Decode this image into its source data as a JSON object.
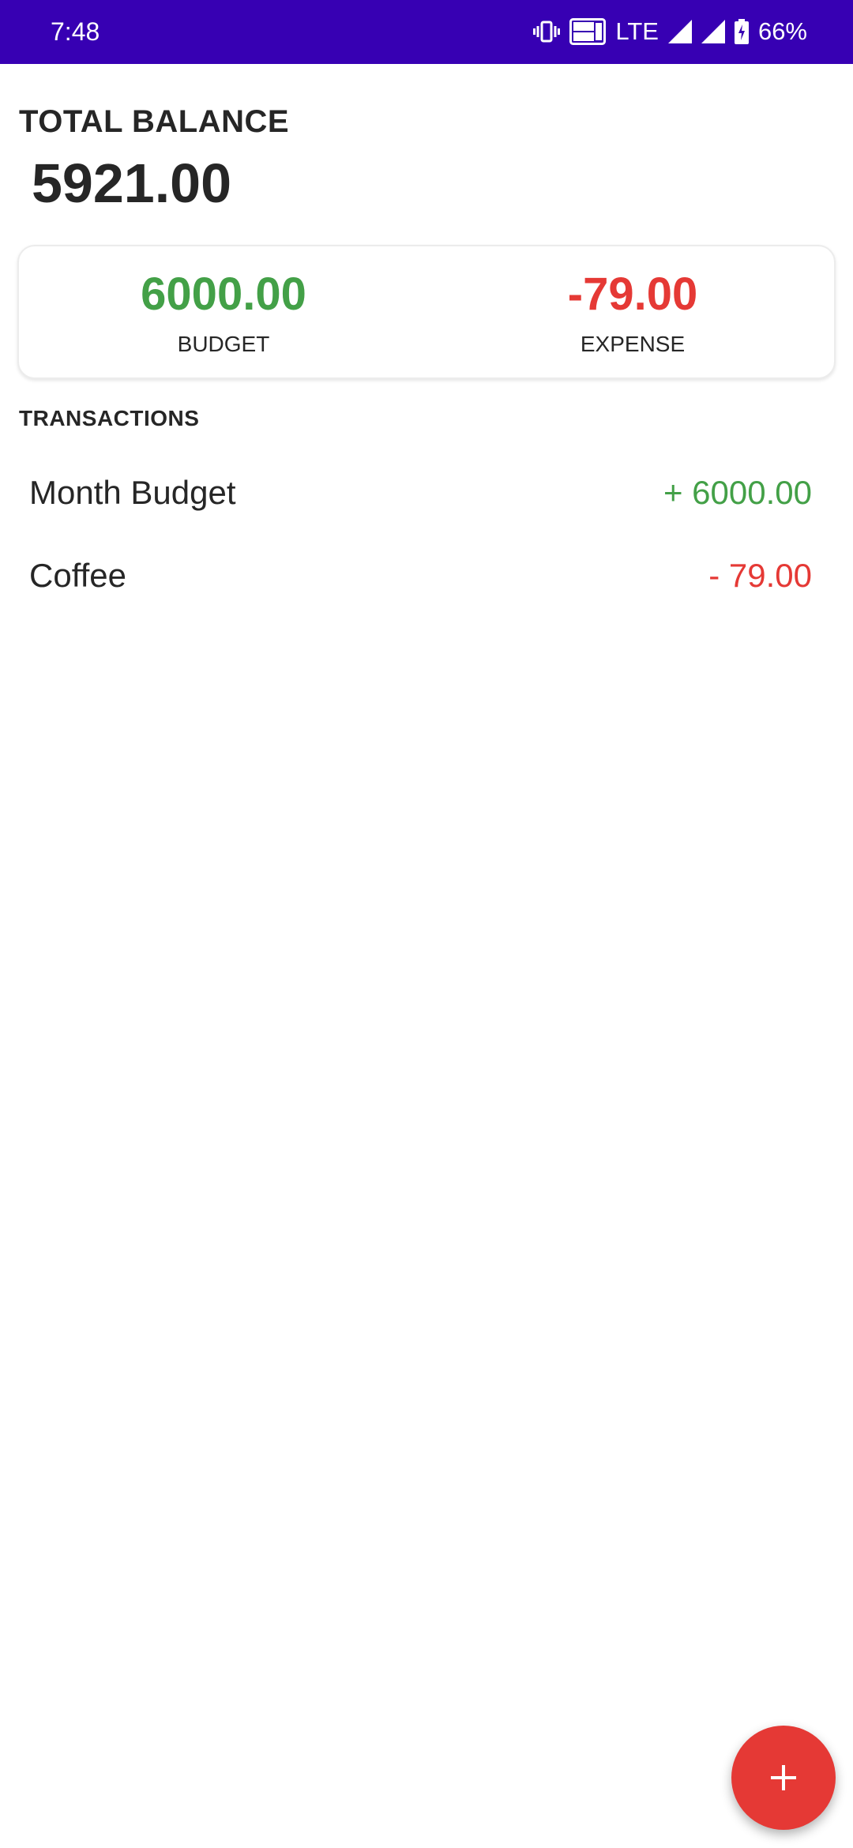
{
  "status_bar": {
    "time": "7:48",
    "network": "LTE",
    "battery": "66%",
    "icons": [
      "vibrate-icon",
      "volte-icon",
      "signal-icon",
      "signal-icon",
      "battery-charging-icon"
    ]
  },
  "header": {
    "total_label": "TOTAL BALANCE",
    "total_value": "5921.00"
  },
  "summary": {
    "budget_amount": "6000.00",
    "budget_label": "BUDGET",
    "expense_amount": "-79.00",
    "expense_label": "EXPENSE"
  },
  "transactions": {
    "heading": "TRANSACTIONS",
    "items": [
      {
        "name": "Month Budget",
        "amount": "+ 6000.00",
        "type": "income"
      },
      {
        "name": "Coffee",
        "amount": "- 79.00",
        "type": "expense"
      }
    ]
  },
  "fab": {
    "icon": "plus-icon"
  },
  "colors": {
    "status_bar": "#3700b3",
    "income": "#43a047",
    "expense": "#e53935",
    "fab": "#e53935"
  }
}
